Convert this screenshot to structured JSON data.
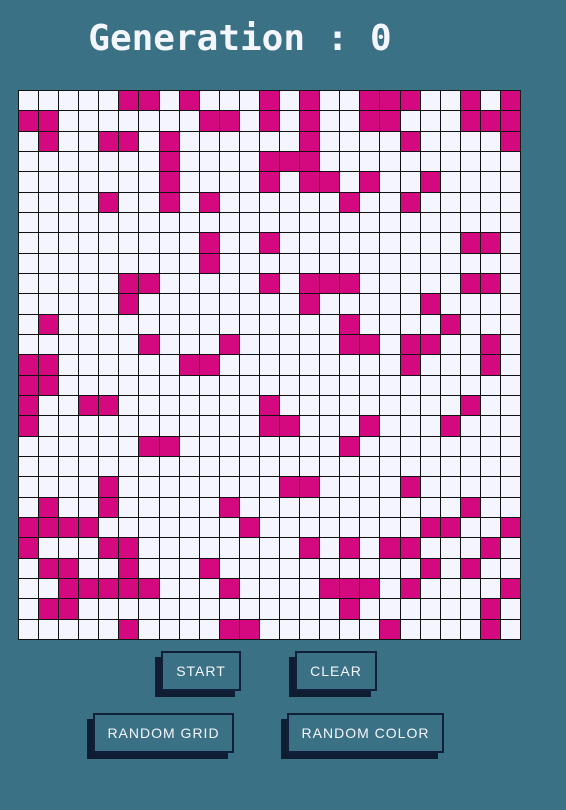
{
  "header": {
    "generation_label": "Generation : 0"
  },
  "grid": {
    "cols": 25,
    "rows": 27,
    "alive_color": "#d4087f",
    "dead_color": "#f4f5ff",
    "line_color": "#111111",
    "cells": [
      "0000011010001010011100101",
      "1100000001101010011000111",
      "0100110100000010000100001",
      "0000000100001110000000000",
      "0000000100001011010010000",
      "0000100101000000100100000",
      "0000000000000000000000000",
      "0000000001001000000000110",
      "0000000001000000000000000",
      "0000011000001011100000110",
      "0000010000000010000010000",
      "0100000000000000100001000",
      "0000001000100000110110010",
      "1100000011000000000100010",
      "1100000000000000000000000",
      "1001100000001000000000100",
      "1000000000001100010001000",
      "0000001100000000100000000",
      "0000000000000000000000000",
      "0000100000000110000100000",
      "0100100000100000000000100",
      "1111000000010000000011001",
      "1000110000000010101100010",
      "0110010001000000000010100",
      "0011111000100001110100001",
      "0110000000000000100000010",
      "0000010000110000001000010"
    ]
  },
  "controls": {
    "start_label": "START",
    "clear_label": "CLEAR",
    "random_grid_label": "RANDOM GRID",
    "random_color_label": "RANDOM COLOR"
  }
}
